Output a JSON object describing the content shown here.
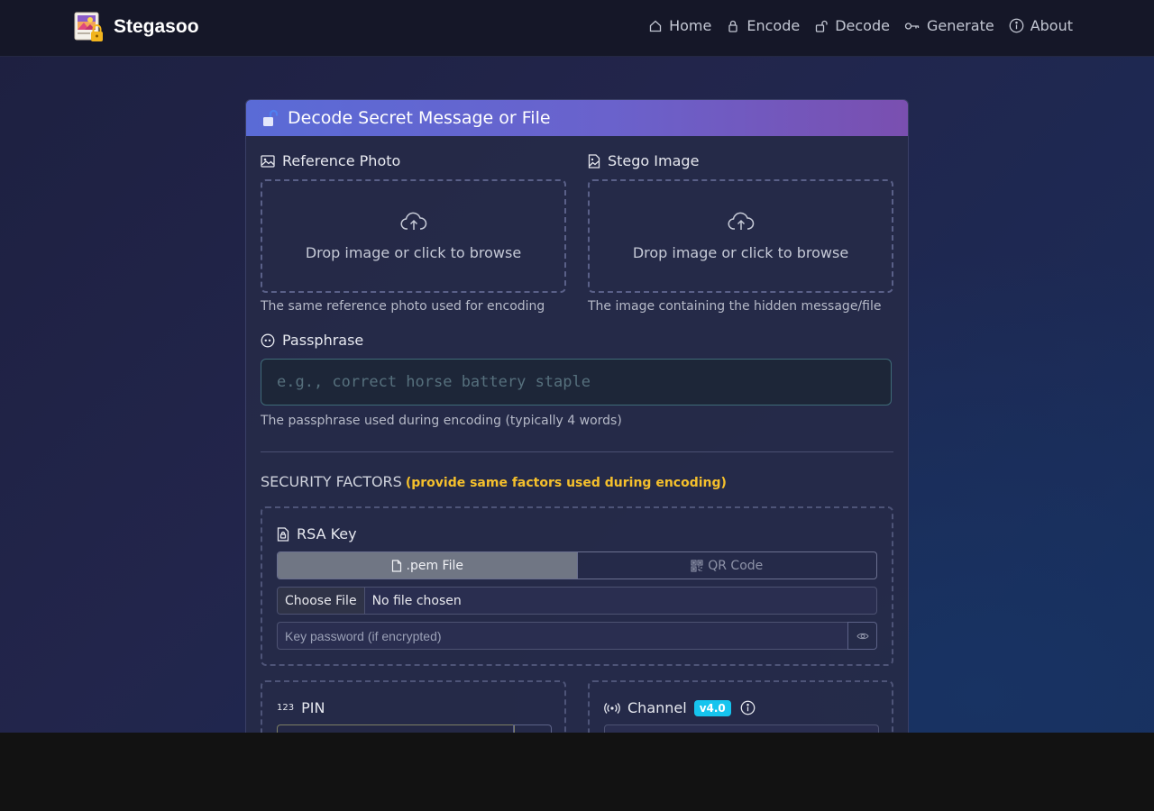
{
  "app": {
    "name": "Stegasoo"
  },
  "nav": {
    "items": [
      {
        "label": "Home",
        "icon": "house-icon"
      },
      {
        "label": "Encode",
        "icon": "lock-icon"
      },
      {
        "label": "Decode",
        "icon": "unlock-icon"
      },
      {
        "label": "Generate",
        "icon": "key-icon"
      },
      {
        "label": "About",
        "icon": "info-icon"
      }
    ]
  },
  "card": {
    "title": "Decode Secret Message or File"
  },
  "reference": {
    "label": "Reference Photo",
    "drop_text": "Drop image or click to browse",
    "help": "The same reference photo used for encoding"
  },
  "stego": {
    "label": "Stego Image",
    "drop_text": "Drop image or click to browse",
    "help": "The image containing the hidden message/file"
  },
  "passphrase": {
    "label": "Passphrase",
    "value": "",
    "placeholder": "e.g., correct horse battery staple",
    "help": "The passphrase used during encoding (typically 4 words)"
  },
  "security": {
    "title": "SECURITY FACTORS",
    "note": "(provide same factors used during encoding)"
  },
  "rsa": {
    "label": "RSA Key",
    "toggle": [
      ".pem File",
      "QR Code"
    ],
    "file_button": "Choose File",
    "file_status": "No file chosen",
    "password_placeholder": "Key password (if encrypted)"
  },
  "pin": {
    "label": "PIN",
    "icon_text": "123"
  },
  "channel": {
    "label": "Channel",
    "badge": "v4.0"
  },
  "colors": {
    "accent_yellow": "#f5c02c",
    "badge_cyan": "#16c4ee",
    "header_start": "#5a6bd6",
    "header_end": "#7a4fb0"
  }
}
